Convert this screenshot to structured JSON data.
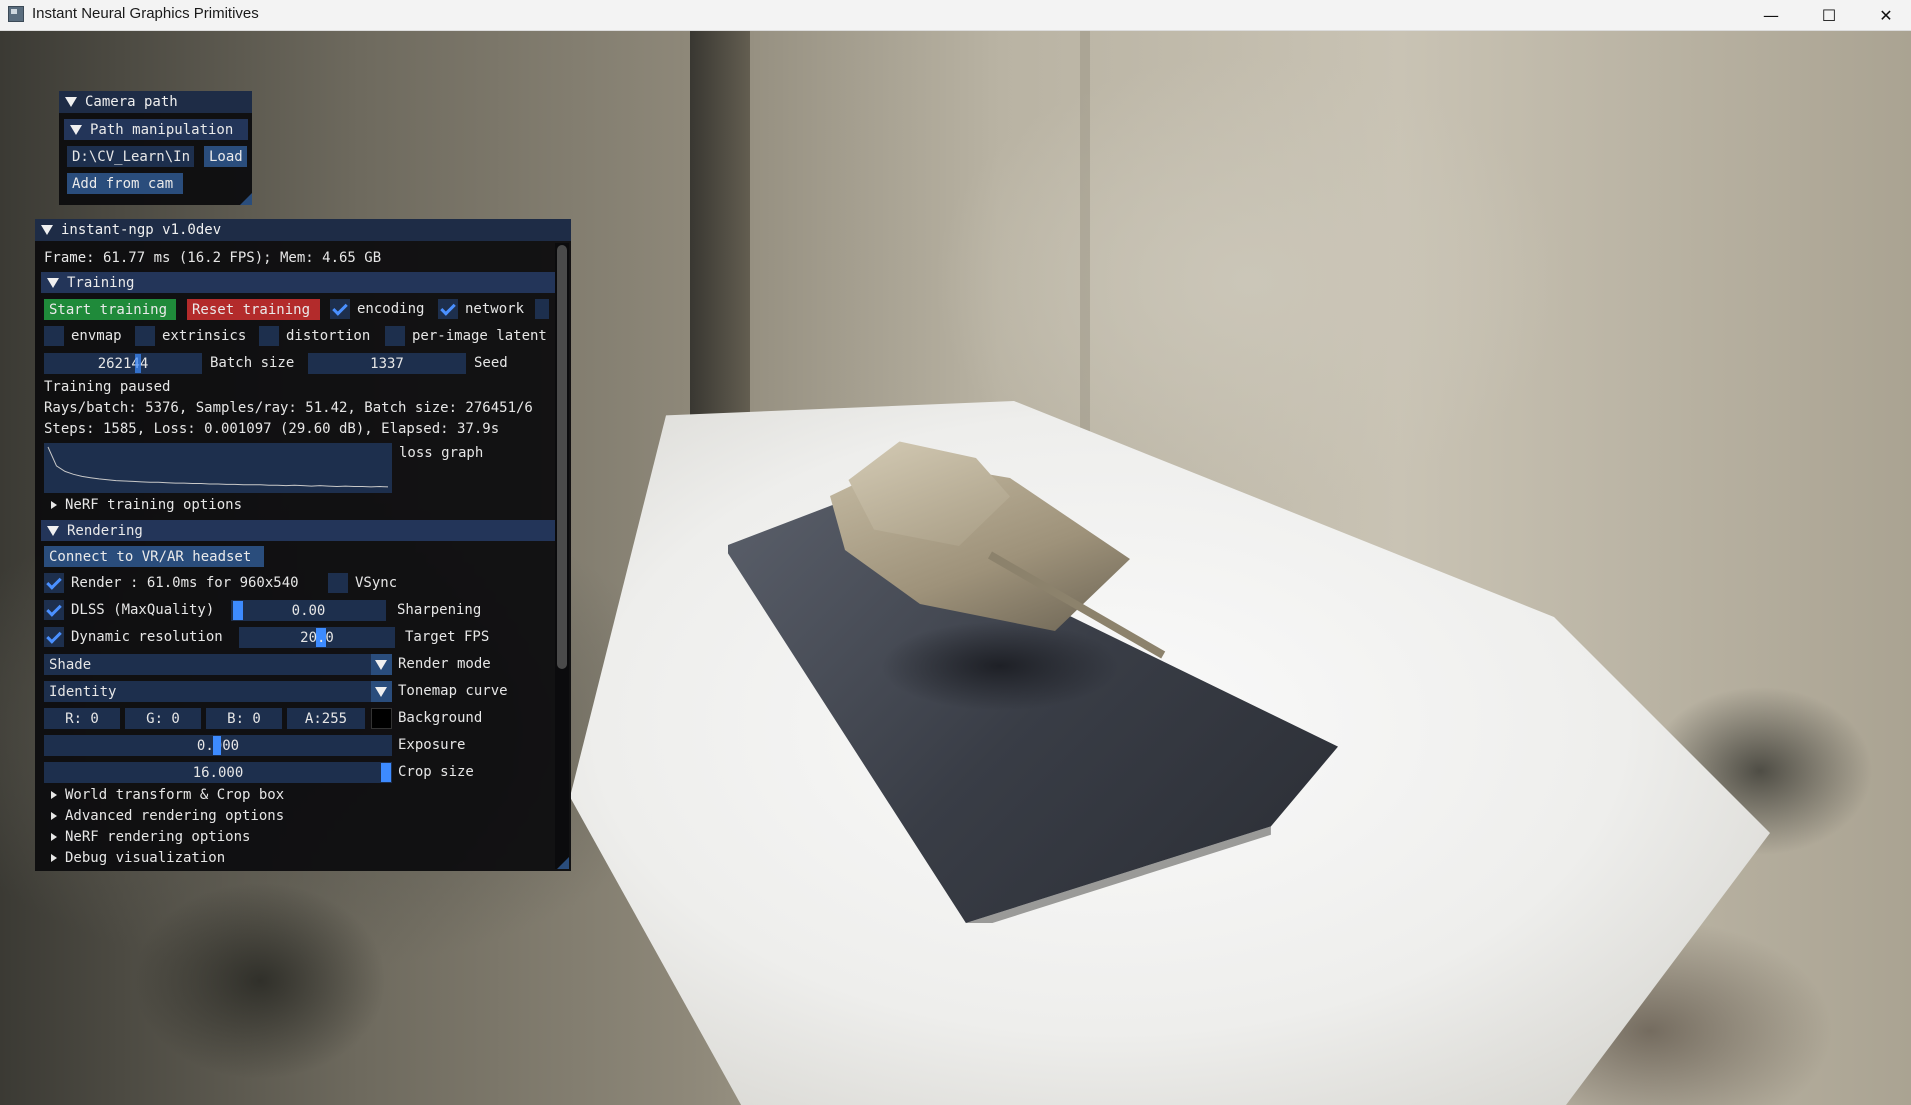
{
  "window": {
    "title": "Instant Neural Graphics Primitives",
    "minimize_glyph": "—",
    "maximize_glyph": "☐",
    "close_glyph": "✕"
  },
  "camera_path": {
    "title": "Camera path",
    "path_manipulation": "Path manipulation",
    "path_value": "D:\\CV_Learn\\In",
    "load_label": "Load",
    "add_from_cam_label": "Add from cam"
  },
  "main": {
    "title": "instant-ngp v1.0dev",
    "frame_info": "Frame: 61.77 ms (16.2 FPS); Mem: 4.65 GB",
    "training": {
      "section_label": "Training",
      "start_label": "Start training",
      "reset_label": "Reset training",
      "encoding_label": "encoding",
      "encoding_checked": true,
      "network_label": "network",
      "network_checked": true,
      "envmap_label": "envmap",
      "extrinsics_label": "extrinsics",
      "distortion_label": "distortion",
      "per_image_latent_label": "per-image latent",
      "batch_size_value": "262144",
      "batch_size_label": "Batch size",
      "seed_value": "1337",
      "seed_label": "Seed",
      "status": "Training paused",
      "rays_info": "Rays/batch: 5376, Samples/ray: 51.42, Batch size: 276451/6",
      "steps_info": "Steps: 1585, Loss: 0.001097 (29.60 dB), Elapsed: 37.9s",
      "loss_graph_label": "loss graph",
      "nerf_training_options": "NeRF training options"
    },
    "rendering": {
      "section_label": "Rendering",
      "vr_button": "Connect to VR/AR headset",
      "render_label": "Render : 61.0ms for 960x540",
      "render_checked": true,
      "vsync_label": "VSync",
      "dlss_label": "DLSS (MaxQuality)",
      "dlss_checked": true,
      "sharpening_value": "0.00",
      "sharpening_label": "Sharpening",
      "dynres_label": "Dynamic resolution",
      "dynres_checked": true,
      "target_fps_value": "20.0",
      "target_fps_label": "Target FPS",
      "render_mode_value": "Shade",
      "render_mode_label": "Render mode",
      "tonemap_value": "Identity",
      "tonemap_label": "Tonemap curve",
      "bg_r": "R:  0",
      "bg_g": "G:  0",
      "bg_b": "B:  0",
      "bg_a": "A:255",
      "background_label": "Background",
      "background_color": "#000000",
      "exposure_value": "0.000",
      "exposure_label": "Exposure",
      "crop_value": "16.000",
      "crop_label": "Crop size",
      "world_transform": "World transform & Crop box",
      "advanced_rendering": "Advanced rendering options",
      "nerf_rendering": "NeRF rendering options",
      "debug_vis": "Debug visualization"
    },
    "loss_curve": [
      1.0,
      0.55,
      0.42,
      0.35,
      0.3,
      0.27,
      0.24,
      0.22,
      0.2,
      0.19,
      0.18,
      0.17,
      0.16,
      0.16,
      0.15,
      0.14,
      0.14,
      0.13,
      0.13,
      0.12,
      0.12,
      0.11,
      0.11,
      0.1,
      0.1,
      0.1,
      0.09,
      0.09,
      0.08,
      0.09,
      0.08,
      0.07,
      0.08,
      0.07,
      0.06,
      0.07,
      0.06,
      0.06,
      0.05,
      0.06,
      0.05
    ]
  },
  "colors": {
    "header": "#1e2c46",
    "section": "#233559",
    "button": "#2a4d7c",
    "start_button": "#1f8a3a",
    "reset_button": "#b32b2b",
    "accent": "#3d8bff"
  }
}
